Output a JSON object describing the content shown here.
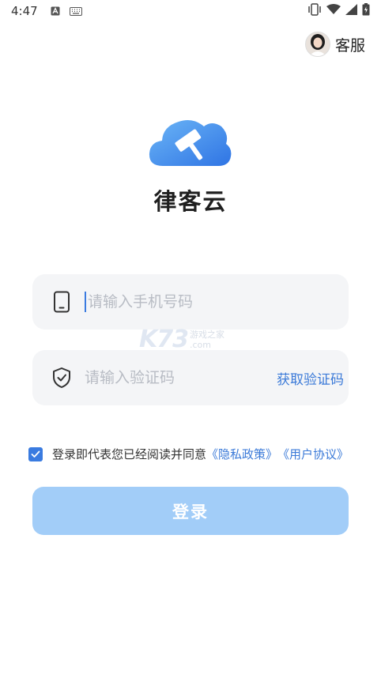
{
  "status_bar": {
    "time": "4:47",
    "icons": [
      "a-notification-icon",
      "keyboard-icon",
      "vibrate-icon",
      "wifi-icon",
      "signal-icon",
      "battery-charging-icon"
    ]
  },
  "header": {
    "service_label": "客服"
  },
  "brand": {
    "app_name": "律客云",
    "logo_colors": [
      "#5aa9f3",
      "#2f74e4"
    ]
  },
  "form": {
    "phone_placeholder": "请输入手机号码",
    "code_placeholder": "请输入验证码",
    "get_code_label": "获取验证码"
  },
  "agreement": {
    "checked": true,
    "text": "登录即代表您已经阅读并同意",
    "privacy_link": "《隐私政策》",
    "user_link": "《用户协议》"
  },
  "login_button": {
    "label": "登录"
  },
  "watermark": {
    "brand": "K73",
    "line1": "游戏之家",
    "line2": ".com"
  },
  "colors": {
    "accent": "#3a7be0",
    "button_disabled": "#a2cdf8",
    "field_bg": "#f4f5f7",
    "placeholder": "#b8bcc4"
  }
}
